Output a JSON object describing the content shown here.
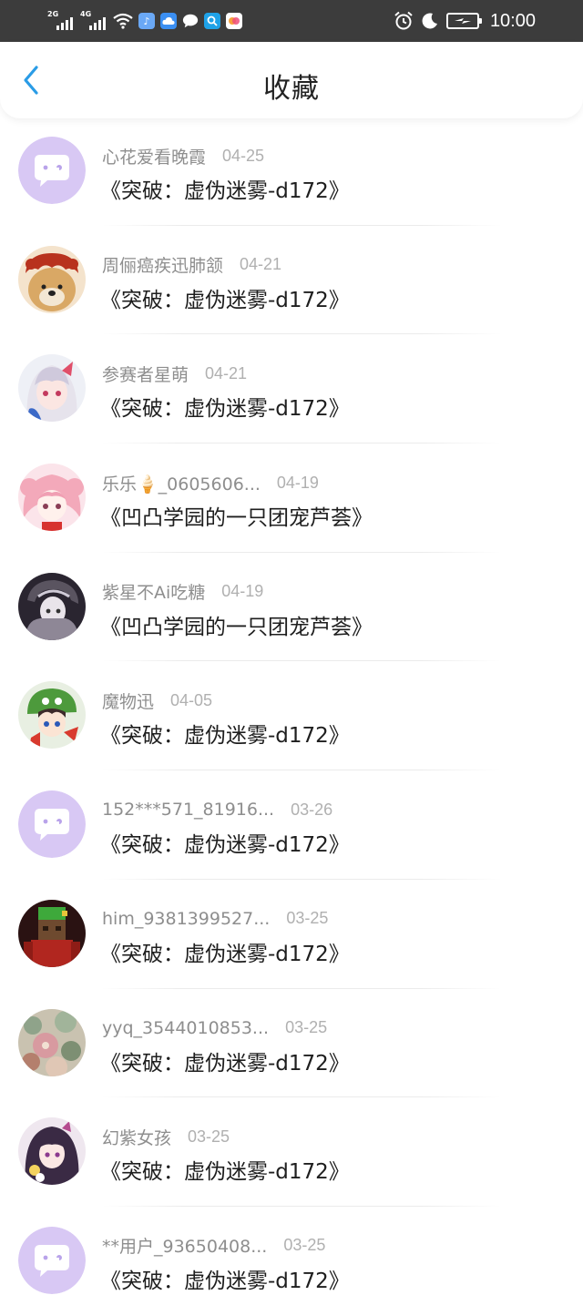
{
  "status_bar": {
    "sim1_type": "2G",
    "sim2_type": "4G",
    "time": "10:00",
    "icons": [
      "signal-icon",
      "signal-icon",
      "wifi-icon",
      "music-app-icon",
      "cloud-app-icon",
      "chat-app-icon",
      "search-app-icon",
      "gallery-app-icon",
      "alarm-icon",
      "moon-icon",
      "battery-charging-icon"
    ]
  },
  "header": {
    "title": "收藏",
    "back_icon": "chevron-left-icon",
    "accent_color": "#2a9ce6"
  },
  "favorites": [
    {
      "user": "心花爱看晚霞",
      "date": "04-25",
      "work": "《突破：虚伪迷雾-d172》",
      "avatar": "default"
    },
    {
      "user": "周俪癌疾迅肺颔",
      "date": "04-21",
      "work": "《突破：虚伪迷雾-d172》",
      "avatar": "dog"
    },
    {
      "user": "参赛者星萌",
      "date": "04-21",
      "work": "《突破：虚伪迷雾-d172》",
      "avatar": "anime-white"
    },
    {
      "user": "乐乐🍦_0605606...",
      "date": "04-19",
      "work": "《凹凸学园的一只团宠芦荟》",
      "avatar": "anime-pink"
    },
    {
      "user": "紫星不Ai吃糖",
      "date": "04-19",
      "work": "《凹凸学园的一只团宠芦荟》",
      "avatar": "anime-dark"
    },
    {
      "user": "魔物迅",
      "date": "04-05",
      "work": "《突破：虚伪迷雾-d172》",
      "avatar": "anime-green"
    },
    {
      "user": "152***571_81916...",
      "date": "03-26",
      "work": "《突破：虚伪迷雾-d172》",
      "avatar": "default"
    },
    {
      "user": "him_9381399527...",
      "date": "03-25",
      "work": "《突破：虚伪迷雾-d172》",
      "avatar": "minecraft"
    },
    {
      "user": "yyq_3544010853...",
      "date": "03-25",
      "work": "《突破：虚伪迷雾-d172》",
      "avatar": "flowers"
    },
    {
      "user": "幻紫女孩",
      "date": "03-25",
      "work": "《突破：虚伪迷雾-d172》",
      "avatar": "anime-purple"
    },
    {
      "user": "**用户_93650408...",
      "date": "03-25",
      "work": "《突破：虚伪迷雾-d172》",
      "avatar": "default"
    }
  ]
}
